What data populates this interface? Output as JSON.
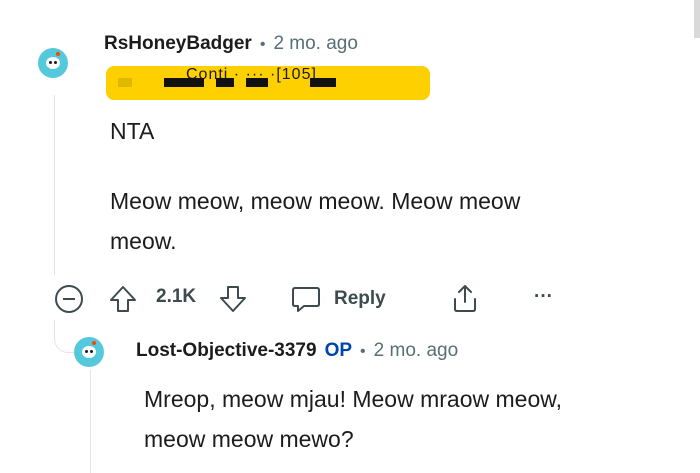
{
  "comment": {
    "username": "RsHoneyBadger",
    "time": "2 mo. ago",
    "flair_visible_text": "Conti · ··· ·[105]",
    "body": [
      "NTA",
      "Meow meow, meow meow. Meow meow",
      "meow."
    ],
    "votes": "2.1K",
    "reply_label": "Reply",
    "more_label": "···",
    "collapse_icon": "minus-circle-icon"
  },
  "reply": {
    "username": "Lost-Objective-3379",
    "op_badge": "OP",
    "time": "2 mo. ago",
    "body": [
      "Mreop, meow mjau! Meow mraow meow,",
      "meow meow mewo?"
    ]
  },
  "colors": {
    "flair_bg": "#ffd000",
    "avatar_bg": "#55c9dc",
    "op_blue": "#0045ac",
    "meta_gray": "#576f76"
  }
}
